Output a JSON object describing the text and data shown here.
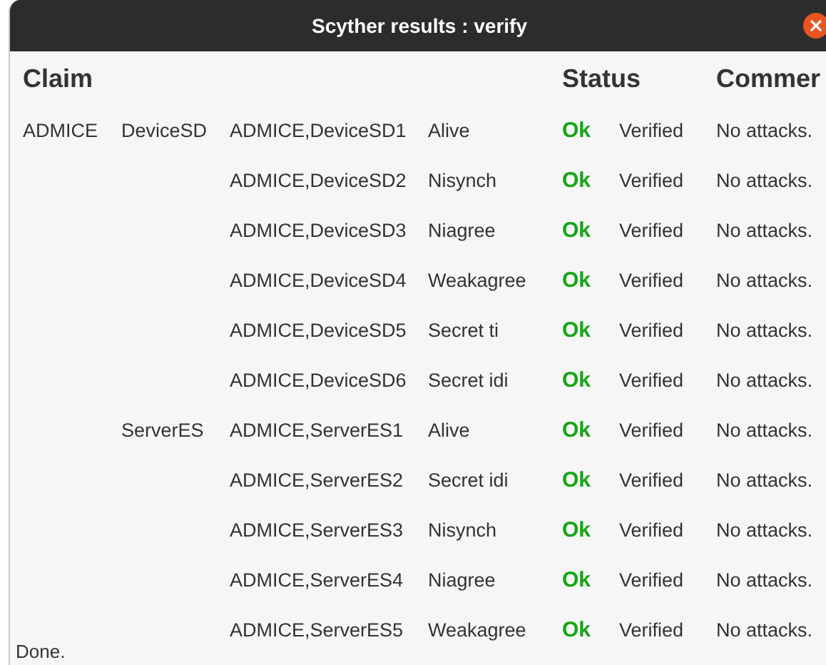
{
  "window": {
    "title": "Scyther results : verify"
  },
  "columns": [
    "Claim",
    "Status",
    "Commer"
  ],
  "rows": [
    {
      "protocol": "ADMICE",
      "role": "DeviceSD",
      "claim": "ADMICE,DeviceSD1",
      "type": "Alive",
      "status": "Ok",
      "verdict": "Verified",
      "comment": "No attacks."
    },
    {
      "claim": "ADMICE,DeviceSD2",
      "type": "Nisynch",
      "status": "Ok",
      "verdict": "Verified",
      "comment": "No attacks."
    },
    {
      "claim": "ADMICE,DeviceSD3",
      "type": "Niagree",
      "status": "Ok",
      "verdict": "Verified",
      "comment": "No attacks."
    },
    {
      "claim": "ADMICE,DeviceSD4",
      "type": "Weakagree",
      "status": "Ok",
      "verdict": "Verified",
      "comment": "No attacks."
    },
    {
      "claim": "ADMICE,DeviceSD5",
      "type": "Secret ti",
      "status": "Ok",
      "verdict": "Verified",
      "comment": "No attacks."
    },
    {
      "claim": "ADMICE,DeviceSD6",
      "type": "Secret idi",
      "status": "Ok",
      "verdict": "Verified",
      "comment": "No attacks."
    },
    {
      "role": "ServerES",
      "claim": "ADMICE,ServerES1",
      "type": "Alive",
      "status": "Ok",
      "verdict": "Verified",
      "comment": "No attacks."
    },
    {
      "claim": "ADMICE,ServerES2",
      "type": "Secret idi",
      "status": "Ok",
      "verdict": "Verified",
      "comment": "No attacks."
    },
    {
      "claim": "ADMICE,ServerES3",
      "type": "Nisynch",
      "status": "Ok",
      "verdict": "Verified",
      "comment": "No attacks."
    },
    {
      "claim": "ADMICE,ServerES4",
      "type": "Niagree",
      "status": "Ok",
      "verdict": "Verified",
      "comment": "No attacks."
    },
    {
      "claim": "ADMICE,ServerES5",
      "type": "Weakagree",
      "status": "Ok",
      "verdict": "Verified",
      "comment": "No attacks."
    }
  ],
  "status_bar": "Done."
}
